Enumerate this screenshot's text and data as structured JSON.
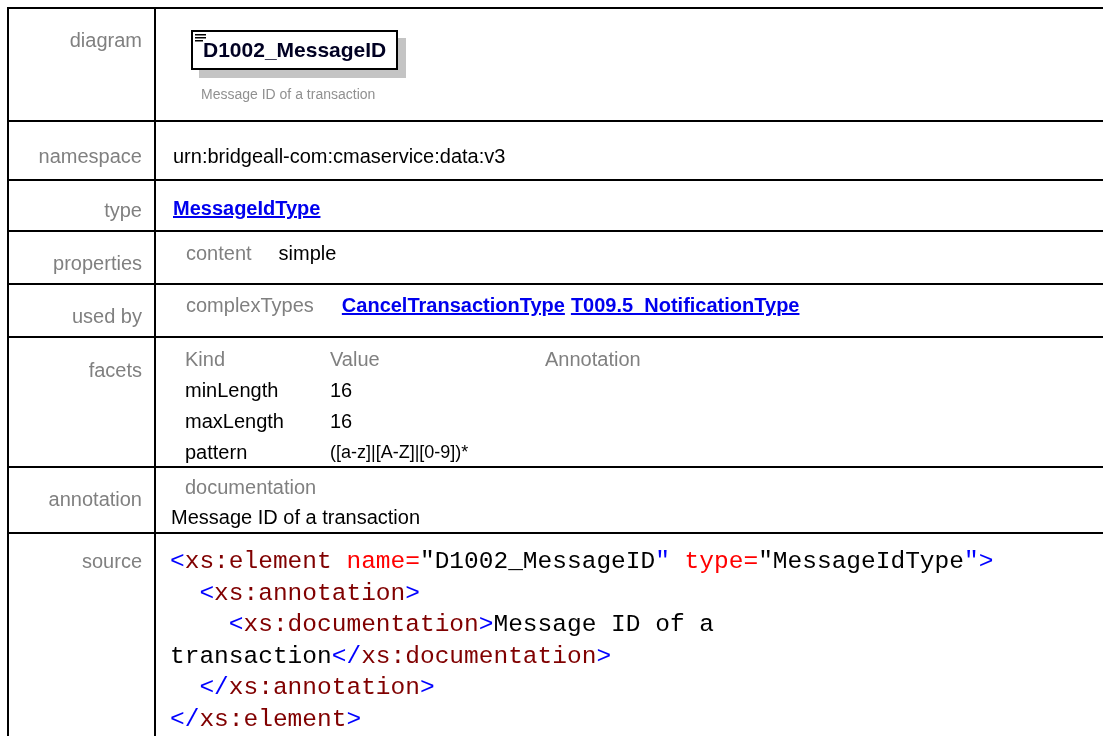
{
  "diagram": {
    "label": "diagram",
    "element_name": "D1002_MessageID",
    "description": "Message ID of a transaction"
  },
  "namespace": {
    "label": "namespace",
    "value": "urn:bridgeall-com:cmaservice:data:v3"
  },
  "type": {
    "label": "type",
    "link": "MessageIdType"
  },
  "properties": {
    "label": "properties",
    "items": [
      {
        "key": "content",
        "value": "simple"
      }
    ]
  },
  "used_by": {
    "label": "used by",
    "category": "complexTypes",
    "links": [
      "CancelTransactionType",
      "T009.5_NotificationType"
    ]
  },
  "facets": {
    "label": "facets",
    "columns": [
      "Kind",
      "Value",
      "Annotation"
    ],
    "rows": [
      {
        "facet": "minLength",
        "value": "16"
      },
      {
        "facet": "maxLength",
        "value": "16"
      },
      {
        "facet": "pattern",
        "value": "([a-z]|[A-Z]|[0-9])*"
      }
    ]
  },
  "annotation": {
    "label": "annotation",
    "heading": "documentation",
    "text": "Message ID of a transaction"
  },
  "source": {
    "label": "source",
    "lines": [
      [
        {
          "kind": "bracket",
          "text": "<"
        },
        {
          "kind": "tag",
          "text": "xs:element"
        },
        {
          "kind": "attr",
          "text": " name="
        },
        {
          "kind": "value",
          "text": "\"D1002_MessageID"
        },
        {
          "kind": "bracket",
          "text": "\""
        },
        {
          "kind": "attr",
          "text": " type="
        },
        {
          "kind": "value",
          "text": "\"MessageIdType"
        },
        {
          "kind": "bracket",
          "text": "\">"
        }
      ],
      [
        {
          "kind": "bracket",
          "text": "  <"
        },
        {
          "kind": "tag",
          "text": "xs:annotation"
        },
        {
          "kind": "bracket",
          "text": ">"
        }
      ],
      [
        {
          "kind": "bracket",
          "text": "    <"
        },
        {
          "kind": "tag",
          "text": "xs:documentation"
        },
        {
          "kind": "bracket",
          "text": ">"
        },
        {
          "kind": "value",
          "text": "Message ID of a"
        }
      ],
      [
        {
          "kind": "value",
          "text": "transaction"
        },
        {
          "kind": "bracket",
          "text": "</"
        },
        {
          "kind": "tag",
          "text": "xs:documentation"
        },
        {
          "kind": "bracket",
          "text": ">"
        }
      ],
      [
        {
          "kind": "bracket",
          "text": "  </"
        },
        {
          "kind": "tag",
          "text": "xs:annotation"
        },
        {
          "kind": "bracket",
          "text": ">"
        }
      ],
      [
        {
          "kind": "bracket",
          "text": "</"
        },
        {
          "kind": "tag",
          "text": "xs:element"
        },
        {
          "kind": "bracket",
          "text": ">"
        }
      ]
    ]
  }
}
